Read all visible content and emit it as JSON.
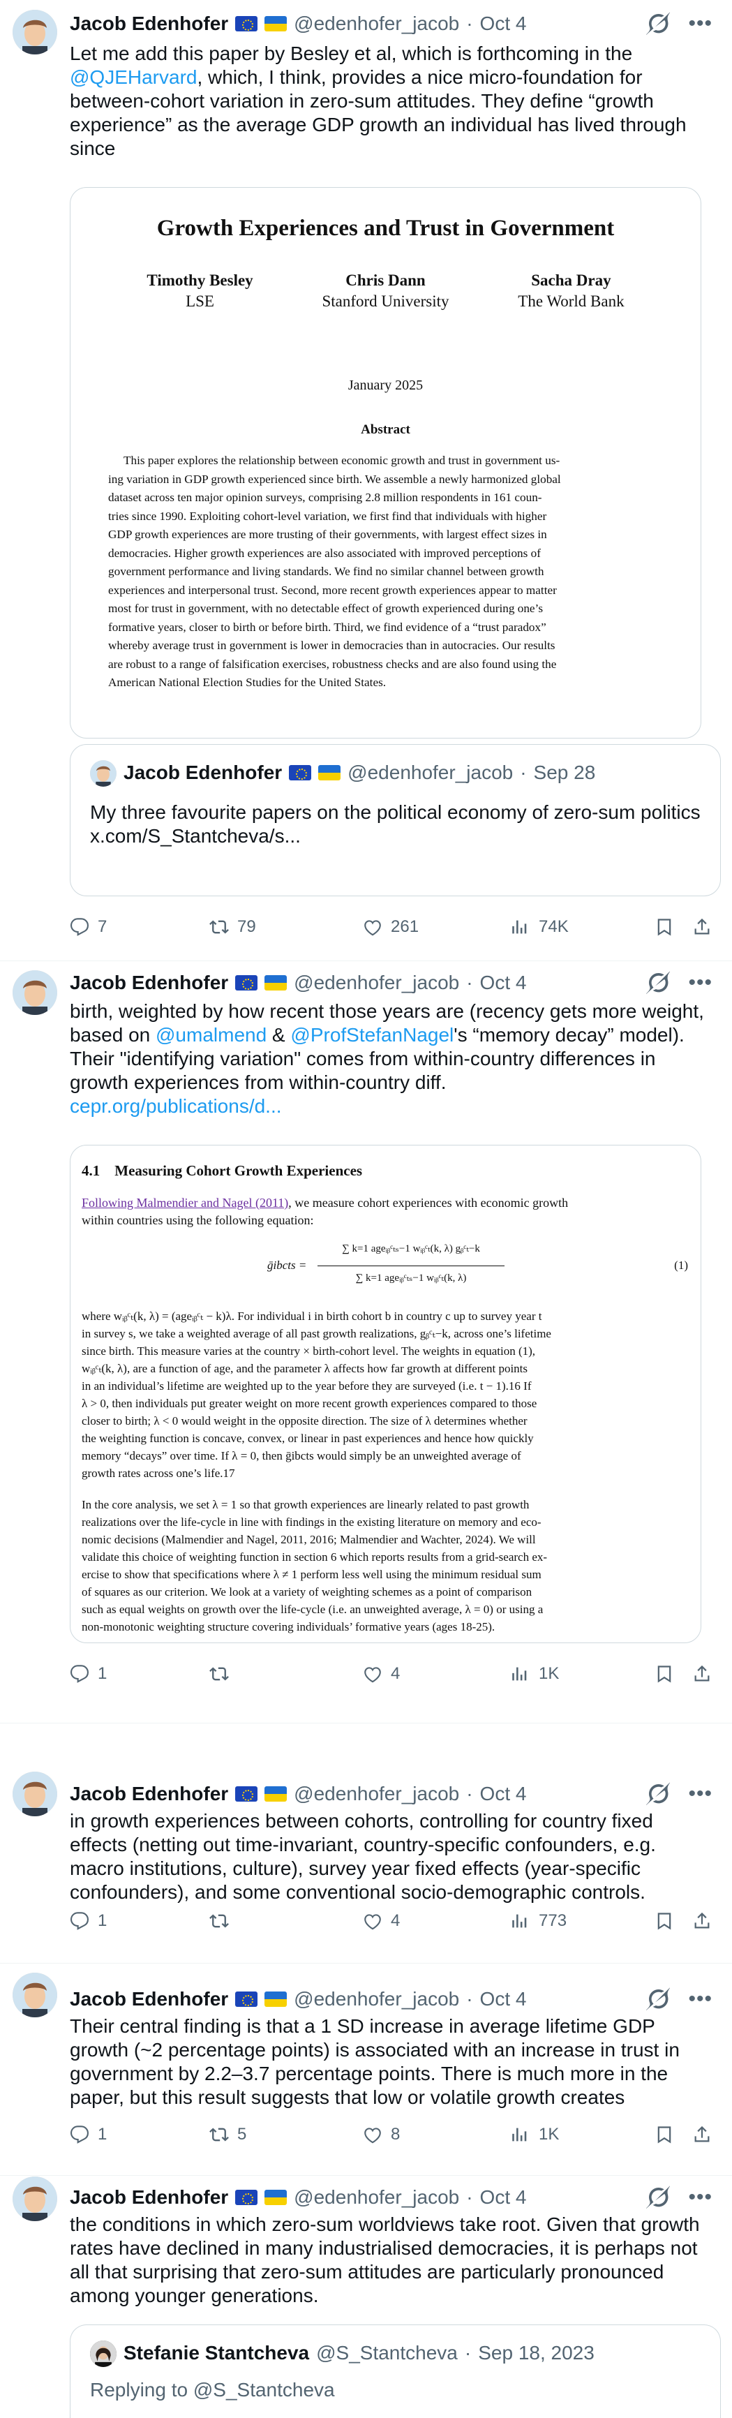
{
  "author": {
    "name": "Jacob Edenhofer",
    "handle": "@edenhofer_jacob"
  },
  "tweets": [
    {
      "date": "Oct 4",
      "text_parts": [
        "Let me add this paper by Besley et al, which is forthcoming in the ",
        "@QJEHarvard",
        ", which, I think, provides a nice micro-foundation for between-cohort variation in zero-sum attitudes. They define “growth experience” as the average GDP growth an individual has lived through since"
      ],
      "paper": {
        "title": "Growth Experiences and Trust in Government",
        "authors": [
          {
            "name": "Timothy Besley",
            "affil": "LSE"
          },
          {
            "name": "Chris Dann",
            "affil": "Stanford University"
          },
          {
            "name": "Sacha Dray",
            "affil": "The World Bank"
          }
        ],
        "date": "January 2025",
        "abstract_heading": "Abstract",
        "abstract_lines": [
          "This paper explores the relationship between economic growth and trust in government us-",
          "ing variation in GDP growth experienced since birth. We assemble a newly harmonized global",
          "dataset across ten major opinion surveys, comprising 2.8 million respondents in 161 coun-",
          "tries since 1990.  Exploiting cohort-level variation, we first find that individuals with higher",
          "GDP growth experiences are more trusting of their governments, with largest effect sizes in",
          "democracies.  Higher growth experiences are also associated with improved perceptions of",
          "government performance and living standards.  We find no similar channel between growth",
          "experiences and interpersonal trust. Second, more recent growth experiences appear to matter",
          "most for trust in government, with no detectable effect of growth experienced during one’s",
          "formative years, closer to birth or before birth.  Third, we find evidence of a “trust paradox”",
          "whereby average trust in government is lower in democracies than in autocracies. Our results",
          "are robust to a range of falsification exercises, robustness checks and are also found using the",
          "American National Election Studies for the United States."
        ]
      },
      "quote": {
        "name": "Jacob Edenhofer",
        "handle": "@edenhofer_jacob",
        "date": "Sep 28",
        "text": "My three favourite papers on the political economy of zero-sum politics",
        "link": "x.com/S_Stantcheva/s..."
      },
      "stats": {
        "replies": "7",
        "reposts": "79",
        "likes": "261",
        "views": "74K"
      }
    },
    {
      "date": "Oct 4",
      "text_parts": [
        "birth, weighted by how recent those years are (recency gets more weight, based on ",
        "@umalmend",
        " & ",
        "@ProfStefanNagel",
        "'s “memory decay” model). Their \"identifying variation\" comes from within-country differences in growth experiences from within-country diff."
      ],
      "link": "cepr.org/publications/d...",
      "section": {
        "heading": "4.1    Measuring Cohort Growth Experiences",
        "intro_link": "Following Malmendier and Nagel (2011)",
        "intro_rest": ", we measure cohort experiences with economic growth",
        "intro_line2": "within countries using the following equation:",
        "eq_lhs": "ḡibcts =",
        "eq_num": "∑ k=1 ageᵢᵦᶜₜₛ−1  wᵢᵦᶜₜ(k, λ) gᵦᶜₜ−k",
        "eq_den": "∑ k=1 ageᵢᵦᶜₜₛ−1  wᵢᵦᶜₜ(k, λ)",
        "eq_no": "(1)",
        "p1": [
          "where wᵢᵦᶜₜ(k, λ) = (ageᵢᵦᶜₜ − k)λ. For individual i in birth cohort b in country c up to survey year t",
          "in survey s, we take a weighted average of all past growth realizations, gᵦᶜₜ−k, across one’s lifetime",
          "since birth. This measure varies at the country × birth-cohort level. The weights in equation (1),",
          "wᵢᵦᶜₜ(k, λ), are a function of age, and the parameter λ affects how far growth at different points",
          "in an individual’s lifetime are weighted up to the year before they are surveyed (i.e. t − 1).16 If",
          "λ > 0, then individuals put greater weight on more recent growth experiences compared to those",
          "closer to birth; λ < 0 would weight in the opposite direction. The size of λ determines whether",
          "the weighting function is concave, convex, or linear in past experiences and hence how quickly",
          "memory “decays” over time.  If λ = 0, then ḡibcts would simply be an unweighted average of",
          "growth rates across one’s life.17"
        ],
        "p2": [
          "In the core analysis, we set λ = 1 so that growth experiences are linearly related to past growth",
          "realizations over the life-cycle in line with findings in the existing literature on memory and eco-",
          "nomic decisions (Malmendier and Nagel, 2011, 2016; Malmendier and Wachter, 2024).  We will",
          "validate this choice of weighting function in section 6 which reports results from a grid-search ex-",
          "ercise to show that specifications where λ ≠ 1 perform less well using the minimum residual sum",
          "of squares as our criterion.  We look at a variety of weighting schemes as a point of comparison",
          "such as equal weights on growth over the life-cycle (i.e. an unweighted average, λ = 0) or using a",
          "non-monotonic weighting structure covering individuals’ formative years (ages 18-25)."
        ]
      },
      "stats": {
        "replies": "1",
        "reposts": "",
        "likes": "4",
        "views": "1K"
      }
    },
    {
      "date": "Oct 4",
      "text": "in growth experiences between cohorts, controlling for country fixed effects (netting out time-invariant, country-specific confounders, e.g. macro institutions, culture), survey year fixed effects (year-specific confounders), and some conventional socio-demographic controls.",
      "stats": {
        "replies": "1",
        "reposts": "",
        "likes": "4",
        "views": "773"
      }
    },
    {
      "date": "Oct 4",
      "text": "Their central finding is that a 1 SD increase in average lifetime GDP growth (~2 percentage points) is associated with an increase in trust in government by 2.2–3.7 percentage points. There is much more in the paper, but this result suggests that low or volatile growth creates",
      "stats": {
        "replies": "1",
        "reposts": "5",
        "likes": "8",
        "views": "1K"
      }
    },
    {
      "date": "Oct 4",
      "text": "the conditions in which zero-sum worldviews take root. Given that growth rates have declined in many industrialised democracies, it is perhaps not all that surprising that zero-sum attitudes are particularly pronounced among younger generations.",
      "quote": {
        "name": "Stefanie Stantcheva",
        "handle": "@S_Stantcheva",
        "date": "Sep 18, 2023",
        "replying": "Replying to @S_Stantcheva"
      }
    }
  ],
  "colors": {
    "link": "#1d9bf0",
    "muted": "#536471",
    "border": "#cfd9de",
    "paper_link": "#6b2fa0"
  },
  "icons": [
    "reply-icon",
    "repost-icon",
    "like-icon",
    "views-icon",
    "bookmark-icon",
    "share-icon",
    "grok-icon",
    "more-icon"
  ]
}
